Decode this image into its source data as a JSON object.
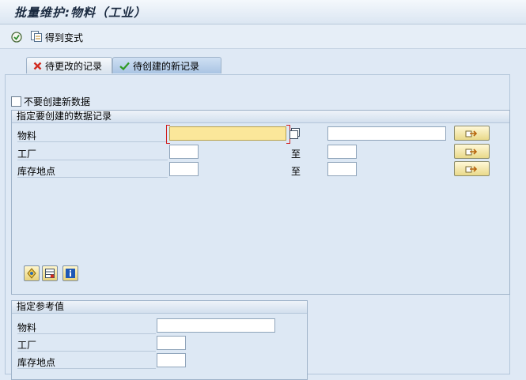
{
  "window": {
    "title": "批量维护:物料（工业）"
  },
  "toolbar": {
    "variant_label": "得到变式"
  },
  "tabs": [
    {
      "label": "待更改的记录",
      "state": "inactive",
      "icon": "red-x-icon"
    },
    {
      "label": "待创建的新记录",
      "state": "active",
      "icon": "green-check-icon"
    }
  ],
  "options": {
    "no_create_label": "不要创建新数据"
  },
  "create_group": {
    "title": "指定要创建的数据记录",
    "rows": [
      {
        "label": "物料",
        "from": "",
        "to_label": "",
        "to": ""
      },
      {
        "label": "工厂",
        "from": "",
        "to_label": "至",
        "to": ""
      },
      {
        "label": "库存地点",
        "from": "",
        "to_label": "至",
        "to": ""
      }
    ]
  },
  "reference_group": {
    "title": "指定参考值",
    "rows": [
      {
        "label": "物料",
        "value": ""
      },
      {
        "label": "工厂",
        "value": ""
      },
      {
        "label": "库存地点",
        "value": ""
      }
    ]
  },
  "colors": {
    "focus_field": "#fbe79a",
    "accent_button": "#e9d98a",
    "bracket": "#d02020"
  }
}
